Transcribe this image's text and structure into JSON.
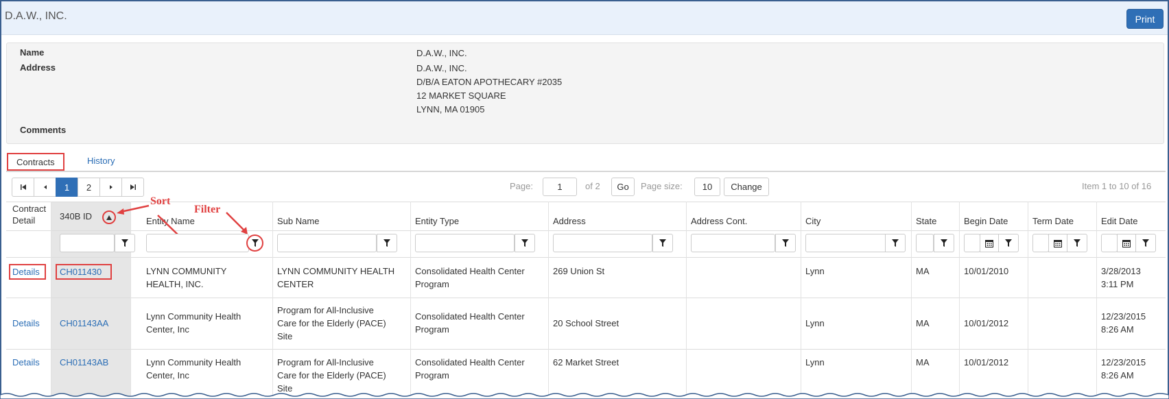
{
  "header": {
    "title": "D.A.W., INC.",
    "print_label": "Print"
  },
  "info": {
    "name_label": "Name",
    "name_value": "D.A.W., INC.",
    "address_label": "Address",
    "address_lines": [
      "D.A.W., INC.",
      "D/B/A EATON APOTHECARY #2035",
      "12 MARKET SQUARE",
      "LYNN, MA 01905"
    ],
    "comments_label": "Comments"
  },
  "tabs": [
    {
      "label": "Contracts",
      "active": true
    },
    {
      "label": "History",
      "active": false
    }
  ],
  "pager": {
    "pages": [
      "1",
      "2"
    ],
    "page_label": "Page:",
    "page_value": "1",
    "of_label": "of 2",
    "go_label": "Go",
    "page_size_label": "Page size:",
    "page_size_value": "10",
    "change_label": "Change",
    "item_info": "Item 1 to 10 of 16"
  },
  "annotations": {
    "sort": "Sort",
    "filter": "Filter"
  },
  "table": {
    "headers": {
      "contract_detail_1": "Contract",
      "contract_detail_2": "Detail",
      "id": "340B ID",
      "entity_name": "Entity Name",
      "sub_name": "Sub Name",
      "entity_type": "Entity Type",
      "address": "Address",
      "address_cont": "Address Cont.",
      "city": "City",
      "state": "State",
      "begin_date": "Begin Date",
      "term_date": "Term Date",
      "edit_date": "Edit Date"
    },
    "rows": [
      {
        "detail": "Details",
        "id": "CH011430",
        "entity_name": [
          "LYNN COMMUNITY",
          "HEALTH, INC."
        ],
        "sub_name": [
          "LYNN COMMUNITY HEALTH",
          "CENTER"
        ],
        "entity_type": [
          "Consolidated Health Center",
          "Program"
        ],
        "address": "269 Union St",
        "address_cont": "",
        "city": "Lynn",
        "state": "MA",
        "begin_date": "10/01/2010",
        "term_date": "",
        "edit_date": [
          "3/28/2013",
          "3:11 PM"
        ]
      },
      {
        "detail": "Details",
        "id": "CH01143AA",
        "entity_name": [
          "Lynn Community Health",
          "Center, Inc"
        ],
        "sub_name": [
          "Program for All-Inclusive",
          "Care for the Elderly (PACE)",
          "Site"
        ],
        "entity_type": [
          "Consolidated Health Center",
          "Program"
        ],
        "address": "20 School Street",
        "address_cont": "",
        "city": "Lynn",
        "state": "MA",
        "begin_date": "10/01/2012",
        "term_date": "",
        "edit_date": [
          "12/23/2015",
          "8:26 AM"
        ]
      },
      {
        "detail": "Details",
        "id": "CH01143AB",
        "entity_name": [
          "Lynn Community Health",
          "Center, Inc"
        ],
        "sub_name": [
          "Program for All-Inclusive",
          "Care for the Elderly (PACE)",
          "Site"
        ],
        "entity_type": [
          "Consolidated Health Center",
          "Program"
        ],
        "address": "62 Market Street",
        "address_cont": "",
        "city": "Lynn",
        "state": "MA",
        "begin_date": "10/01/2012",
        "term_date": "",
        "edit_date": [
          "12/23/2015",
          "8:26 AM"
        ]
      }
    ]
  },
  "colors": {
    "accent": "#2f6fb6",
    "annotation": "#e04040",
    "header_bg": "#e9f1fb"
  }
}
